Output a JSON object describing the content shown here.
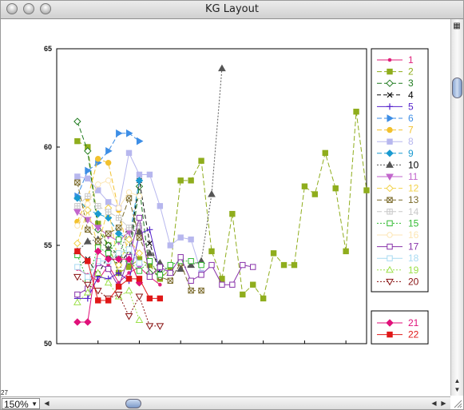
{
  "window": {
    "title": "KG Layout"
  },
  "view": {
    "zoom_label": "150%",
    "corner_label": "27"
  },
  "colors": {
    "axis": "#000000",
    "tick_text": "#111111"
  },
  "chart_data": {
    "type": "line",
    "title": "",
    "xlabel": "",
    "ylabel": "",
    "ylim": [
      50,
      65
    ],
    "yticks": [
      "50",
      "55",
      "60",
      "65"
    ],
    "xlim": [
      0,
      15
    ],
    "xticks": [
      2,
      4,
      6,
      8,
      10,
      12,
      14
    ],
    "grid": false,
    "legend": "right",
    "series": [
      {
        "name": "1",
        "color": "#e0217a",
        "marker": "dot",
        "dash": "",
        "x": [
          1.0,
          1.5,
          2.0,
          2.5,
          3.0,
          3.5,
          4.0,
          4.5,
          5.0
        ],
        "y": [
          53.8,
          53.5,
          53.2,
          54.0,
          53.1,
          53.6,
          53.9,
          53.4,
          53.0
        ]
      },
      {
        "name": "2",
        "color": "#8fad1d",
        "marker": "square",
        "dash": "6 3",
        "x": [
          1.0,
          1.5,
          2.0,
          2.5,
          3.0,
          3.5,
          4.0,
          4.5,
          5.0,
          5.5,
          6.0,
          6.5,
          7.0,
          7.5,
          8.0,
          8.5,
          9.0,
          9.5,
          10.0,
          10.5,
          11.0,
          11.5,
          12.0,
          12.5,
          13.0,
          13.5,
          14.0,
          14.5,
          15.0
        ],
        "y": [
          60.3,
          60.0,
          56.1,
          55.0,
          53.6,
          53.9,
          54.3,
          54.0,
          53.3,
          53.8,
          58.3,
          58.3,
          59.3,
          54.7,
          53.3,
          56.6,
          52.5,
          53.0,
          52.3,
          54.6,
          54.0,
          54.0,
          58.0,
          57.6,
          59.7,
          57.9,
          54.7,
          61.8,
          57.8
        ]
      },
      {
        "name": "3",
        "color": "#1e7a1e",
        "marker": "diamond-open",
        "dash": "6 3",
        "x": [
          1.0,
          1.5,
          2.0,
          2.5,
          3.0,
          3.5,
          4.0,
          4.5,
          5.0
        ],
        "y": [
          61.3,
          59.8,
          55.8,
          55.0,
          54.5,
          54.2,
          58.0,
          53.6,
          53.5
        ]
      },
      {
        "name": "4",
        "color": "#111111",
        "marker": "x",
        "dash": "5 3",
        "x": [
          1.0,
          1.5,
          2.0,
          2.5,
          3.0,
          3.5,
          4.0,
          4.5,
          5.0
        ],
        "y": [
          53.9,
          54.3,
          53.5,
          54.5,
          54.0,
          54.7,
          58.3,
          55.1,
          53.6
        ]
      },
      {
        "name": "5",
        "color": "#5522cc",
        "marker": "plus",
        "dash": "",
        "x": [
          1.0,
          1.5,
          2.0,
          2.5,
          3.0,
          3.5,
          4.0,
          4.5,
          5.0
        ],
        "y": [
          52.3,
          52.3,
          53.4,
          53.3,
          53.6,
          53.2,
          55.6,
          55.8,
          53.6
        ]
      },
      {
        "name": "6",
        "color": "#3d8ee6",
        "marker": "tri-right",
        "dash": "6 3",
        "x": [
          1.0,
          1.5,
          2.0,
          2.5,
          3.0,
          3.5,
          4.0
        ],
        "y": [
          57.5,
          58.8,
          59.2,
          59.8,
          60.7,
          60.7,
          60.3
        ]
      },
      {
        "name": "7",
        "color": "#f2c12e",
        "marker": "dot-big",
        "dash": "6 3",
        "x": [
          1.0,
          1.5,
          2.0,
          2.5,
          3.0,
          3.5,
          4.0
        ],
        "y": [
          56.2,
          57.4,
          59.4,
          59.2,
          56.8,
          54.4,
          53.1
        ]
      },
      {
        "name": "8",
        "color": "#b7b7ee",
        "marker": "square",
        "dash": "",
        "x": [
          1.0,
          1.5,
          2.0,
          2.5,
          3.0,
          3.5,
          4.0,
          4.5,
          5.0,
          5.5,
          6.0,
          6.5,
          7.0
        ],
        "y": [
          58.5,
          58.4,
          57.8,
          57.2,
          56.9,
          59.7,
          58.6,
          58.6,
          57.0,
          55.0,
          55.4,
          55.3,
          53.6
        ]
      },
      {
        "name": "9",
        "color": "#1a9ad0",
        "marker": "diamond",
        "dash": "6 3",
        "x": [
          1.0,
          1.5,
          2.0,
          2.5,
          3.0,
          3.5,
          4.0
        ],
        "y": [
          57.4,
          56.8,
          56.6,
          56.4,
          55.6,
          55.3,
          58.3
        ]
      },
      {
        "name": "10",
        "color": "#555555",
        "marker": "triangle",
        "dash": "2 2",
        "x": [
          1.0,
          1.5,
          2.0,
          2.5,
          3.0,
          3.5,
          4.0,
          4.5,
          5.0,
          5.5,
          6.0,
          6.5,
          7.0,
          7.5,
          8.0
        ],
        "y": [
          54.7,
          55.2,
          55.3,
          54.8,
          54.5,
          55.8,
          55.7,
          54.6,
          54.1,
          53.6,
          53.8,
          54.0,
          54.2,
          57.6,
          64.0
        ]
      },
      {
        "name": "11",
        "color": "#c266cc",
        "marker": "triangle-down",
        "dash": "",
        "x": [
          1.0,
          1.5,
          2.0,
          2.5,
          3.0,
          3.5,
          4.0
        ],
        "y": [
          56.7,
          56.3,
          55.9,
          55.5,
          55.2,
          55.7,
          53.9
        ]
      },
      {
        "name": "12",
        "color": "#f2d24a",
        "marker": "diamond-open",
        "dash": "6 3",
        "x": [
          1.0,
          1.5,
          2.0,
          2.5,
          3.0,
          3.5,
          4.0
        ],
        "y": [
          55.1,
          56.8,
          55.0,
          56.9,
          54.0,
          55.3,
          54.6
        ]
      },
      {
        "name": "13",
        "color": "#7a6a2a",
        "marker": "square-x",
        "dash": "6 3",
        "x": [
          1.0,
          1.5,
          2.0,
          2.5,
          3.0,
          3.5,
          4.0,
          4.5,
          5.0,
          5.5,
          6.0,
          6.5,
          7.0
        ],
        "y": [
          58.2,
          55.8,
          55.2,
          55.6,
          55.9,
          57.4,
          55.4,
          54.2,
          53.4,
          53.2,
          54.1,
          52.7,
          52.7
        ]
      },
      {
        "name": "14",
        "color": "#c8c8c8",
        "marker": "square-plus",
        "dash": "6 3",
        "x": [
          1.0,
          1.5,
          2.0,
          2.5,
          3.0,
          3.5,
          4.0
        ],
        "y": [
          57.0,
          57.5,
          57.0,
          56.7,
          56.4,
          55.9,
          56.0
        ]
      },
      {
        "name": "15",
        "color": "#33bb33",
        "marker": "square-open",
        "dash": "2 2",
        "x": [
          1.0,
          1.5,
          2.0,
          2.5,
          3.0,
          3.5,
          4.0,
          4.5,
          5.0,
          5.5,
          6.0,
          6.5,
          7.0
        ],
        "y": [
          54.5,
          53.2,
          54.9,
          54.6,
          55.3,
          54.2,
          53.7,
          54.2,
          53.5,
          54.0,
          54.2,
          54.2,
          54.0
        ]
      },
      {
        "name": "16",
        "color": "#fce6b4",
        "marker": "circle-open",
        "dash": "",
        "x": [
          1.0,
          1.5,
          2.0,
          2.5,
          3.0,
          3.5,
          4.0
        ],
        "y": [
          56.0,
          57.1,
          58.1,
          58.3,
          56.9,
          57.7,
          57.5
        ]
      },
      {
        "name": "17",
        "color": "#8833aa",
        "marker": "square-open",
        "dash": "",
        "x": [
          1.0,
          1.5,
          2.0,
          2.5,
          3.0,
          3.5,
          4.0,
          4.5,
          5.0,
          5.5,
          6.0,
          6.5,
          7.0,
          7.5,
          8.0,
          8.5,
          9.0,
          9.5
        ],
        "y": [
          52.5,
          52.8,
          54.1,
          53.8,
          52.9,
          54.4,
          56.4,
          53.4,
          53.9,
          53.6,
          54.4,
          53.2,
          53.5,
          54.0,
          53.0,
          53.0,
          54.0,
          53.9
        ]
      },
      {
        "name": "18",
        "color": "#a9dbf2",
        "marker": "square-open",
        "dash": "",
        "x": [
          1.0,
          1.5,
          2.0,
          2.5,
          3.0,
          3.5,
          4.0
        ],
        "y": [
          53.9,
          53.4,
          54.2,
          54.2,
          54.6,
          54.8,
          54.1
        ]
      },
      {
        "name": "19",
        "color": "#9ce04a",
        "marker": "triangle-open",
        "dash": "2 2",
        "x": [
          1.0,
          1.5,
          2.0,
          2.5,
          3.0,
          3.5,
          4.0
        ],
        "y": [
          52.1,
          52.6,
          53.6,
          53.1,
          52.4,
          52.7,
          51.2
        ]
      },
      {
        "name": "20",
        "color": "#881111",
        "marker": "triangle-down-open",
        "dash": "2 2",
        "x": [
          1.0,
          1.5,
          2.0,
          2.5,
          3.0,
          3.5,
          4.0,
          4.5,
          5.0
        ],
        "y": [
          53.4,
          53.0,
          52.7,
          52.3,
          52.5,
          51.4,
          52.4,
          50.9,
          50.9
        ]
      },
      {
        "name": "21",
        "color": "#e0117a",
        "marker": "diamond",
        "dash": "",
        "x": [
          1.0,
          1.5,
          2.0,
          2.5,
          3.0,
          3.5,
          4.0
        ],
        "y": [
          51.1,
          51.1,
          54.7,
          54.3,
          54.3,
          54.3,
          53.1
        ]
      },
      {
        "name": "22",
        "color": "#e01818",
        "marker": "square",
        "dash": "",
        "x": [
          1.0,
          1.5,
          2.0,
          2.5,
          3.0,
          3.5,
          4.0,
          4.5,
          5.0
        ],
        "y": [
          54.7,
          54.2,
          52.2,
          52.2,
          52.9,
          53.3,
          53.3,
          52.3,
          52.3
        ]
      }
    ],
    "legend_groups": [
      [
        "1",
        "2",
        "3",
        "4",
        "5",
        "6",
        "7",
        "8",
        "9",
        "10",
        "11",
        "12",
        "13",
        "14",
        "15",
        "16",
        "17",
        "18",
        "19",
        "20"
      ],
      [
        "21",
        "22"
      ]
    ]
  }
}
